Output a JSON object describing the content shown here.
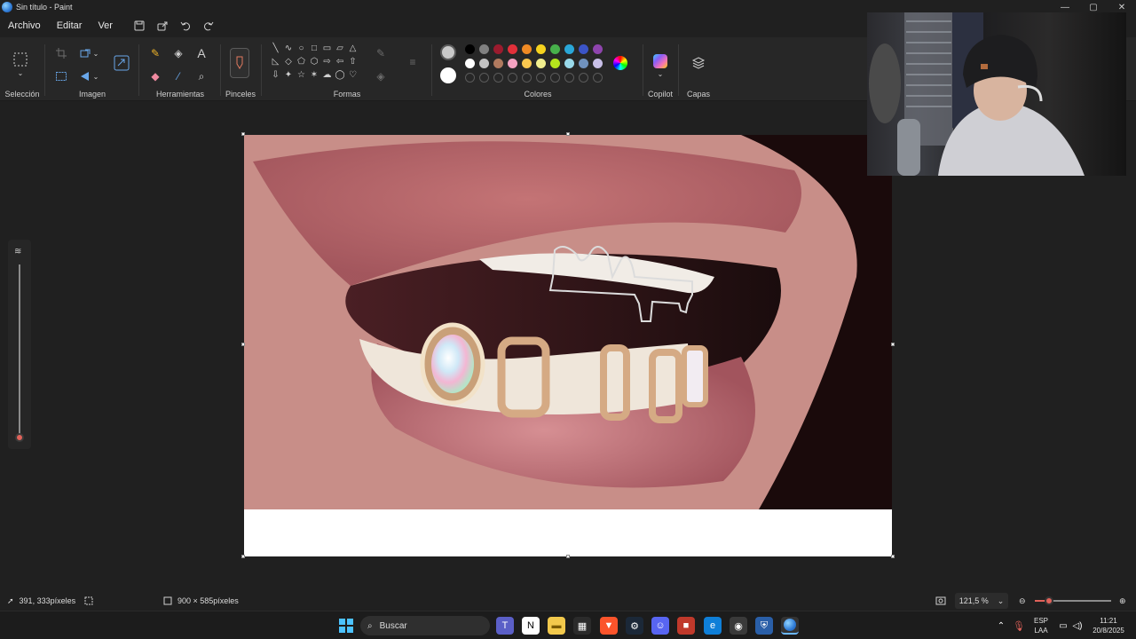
{
  "window": {
    "title": "Sin título - Paint",
    "controls": {
      "minimize": "—",
      "maximize": "▢",
      "close": "✕"
    }
  },
  "menu": {
    "items": [
      "Archivo",
      "Editar",
      "Ver"
    ],
    "icons": [
      "save-icon",
      "share-icon",
      "undo-icon",
      "redo-icon"
    ]
  },
  "ribbon": {
    "groups": {
      "selection": "Selección",
      "image": "Imagen",
      "tools": "Herramientas",
      "brushes": "Pinceles",
      "shapes": "Formas",
      "colors": "Colores",
      "copilot": "Copilot",
      "layers": "Capas"
    },
    "tool_glyphs": {
      "text": "A",
      "zoom": "⌕",
      "pencil": "✎",
      "eraser": "◆",
      "fill": "◈",
      "picker": "⁄"
    },
    "shape_glyphs": [
      "╲",
      "∿",
      "○",
      "□",
      "▭",
      "▱",
      "△",
      "◺",
      "◇",
      "⬠",
      "⬡",
      "⇨",
      "⇦",
      "⇧",
      "⇩",
      "✦",
      "☆",
      "✶",
      "☁",
      "◯",
      "♡"
    ],
    "colors": {
      "primary": "#c9c9c9",
      "secondary": "#ffffff",
      "row1": [
        "#000000",
        "#808080",
        "#9b1b2e",
        "#e2303a",
        "#f08a24",
        "#f5d21e",
        "#47b04b",
        "#2aa7d8",
        "#3b54c7",
        "#8e44ad"
      ],
      "row2": [
        "#ffffff",
        "#c3c3c3",
        "#b07a5f",
        "#f4a2c1",
        "#f9c74f",
        "#f1ee8e",
        "#b5e61d",
        "#99d9ea",
        "#7092be",
        "#c8bfe7"
      ]
    }
  },
  "status": {
    "cursor": "391, 333píxeles",
    "size": "900 × 585píxeles",
    "zoom": "121,5 %",
    "zoom_fraction": 0.19
  },
  "taskbar": {
    "search_label": "Buscar",
    "lang_line1": "ESP",
    "lang_line2": "LAA",
    "time": "11:21",
    "date": "20/8/2025"
  }
}
